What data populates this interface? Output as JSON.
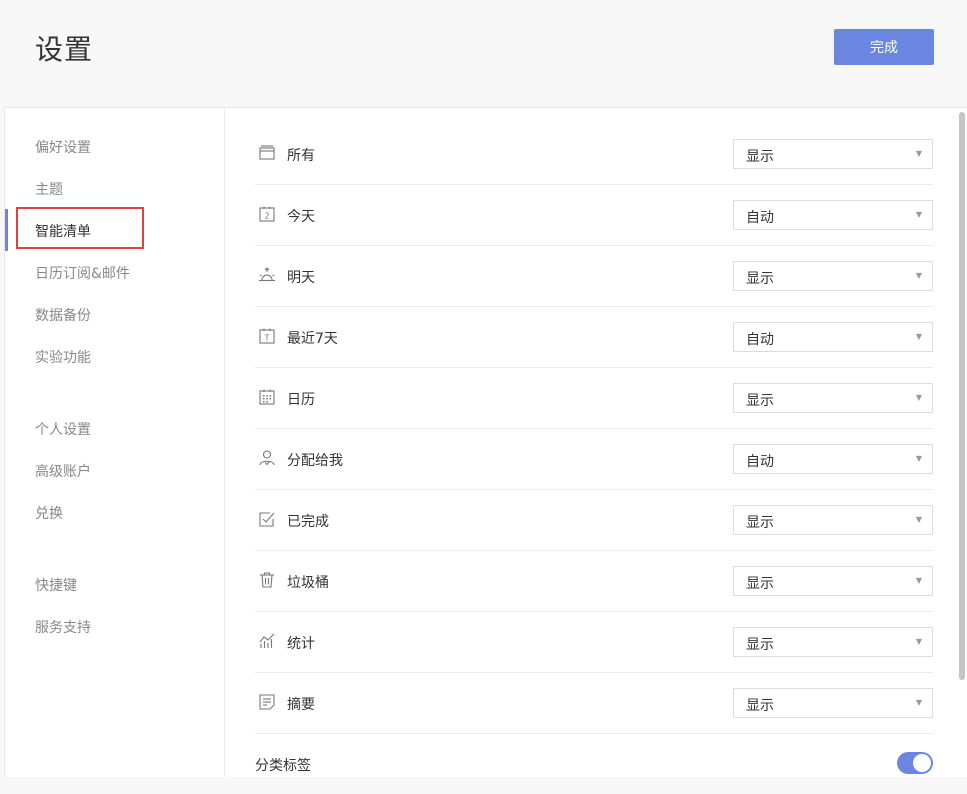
{
  "header": {
    "title": "设置",
    "done_label": "完成"
  },
  "sidebar": {
    "items": [
      {
        "label": "偏好设置"
      },
      {
        "label": "主题"
      },
      {
        "label": "智能清单"
      },
      {
        "label": "日历订阅&邮件"
      },
      {
        "label": "数据备份"
      },
      {
        "label": "实验功能"
      },
      {
        "label": "个人设置"
      },
      {
        "label": "高级账户"
      },
      {
        "label": "兑换"
      },
      {
        "label": "快捷键"
      },
      {
        "label": "服务支持"
      }
    ]
  },
  "rows": [
    {
      "label": "所有",
      "value": "显示",
      "icon": "inbox-icon"
    },
    {
      "label": "今天",
      "value": "自动",
      "icon": "calendar-today-icon",
      "icon_text": "2"
    },
    {
      "label": "明天",
      "value": "显示",
      "icon": "sunrise-icon"
    },
    {
      "label": "最近7天",
      "value": "自动",
      "icon": "calendar-week-icon",
      "icon_text": "T"
    },
    {
      "label": "日历",
      "value": "显示",
      "icon": "calendar-grid-icon"
    },
    {
      "label": "分配给我",
      "value": "自动",
      "icon": "person-assign-icon"
    },
    {
      "label": "已完成",
      "value": "显示",
      "icon": "checkbox-icon"
    },
    {
      "label": "垃圾桶",
      "value": "显示",
      "icon": "trash-icon"
    },
    {
      "label": "统计",
      "value": "显示",
      "icon": "statistics-icon"
    },
    {
      "label": "摘要",
      "value": "显示",
      "icon": "summary-icon"
    }
  ],
  "tags_toggle": {
    "label": "分类标签",
    "on": true
  },
  "colors": {
    "accent": "#6b86e0",
    "highlight": "#e04040"
  }
}
